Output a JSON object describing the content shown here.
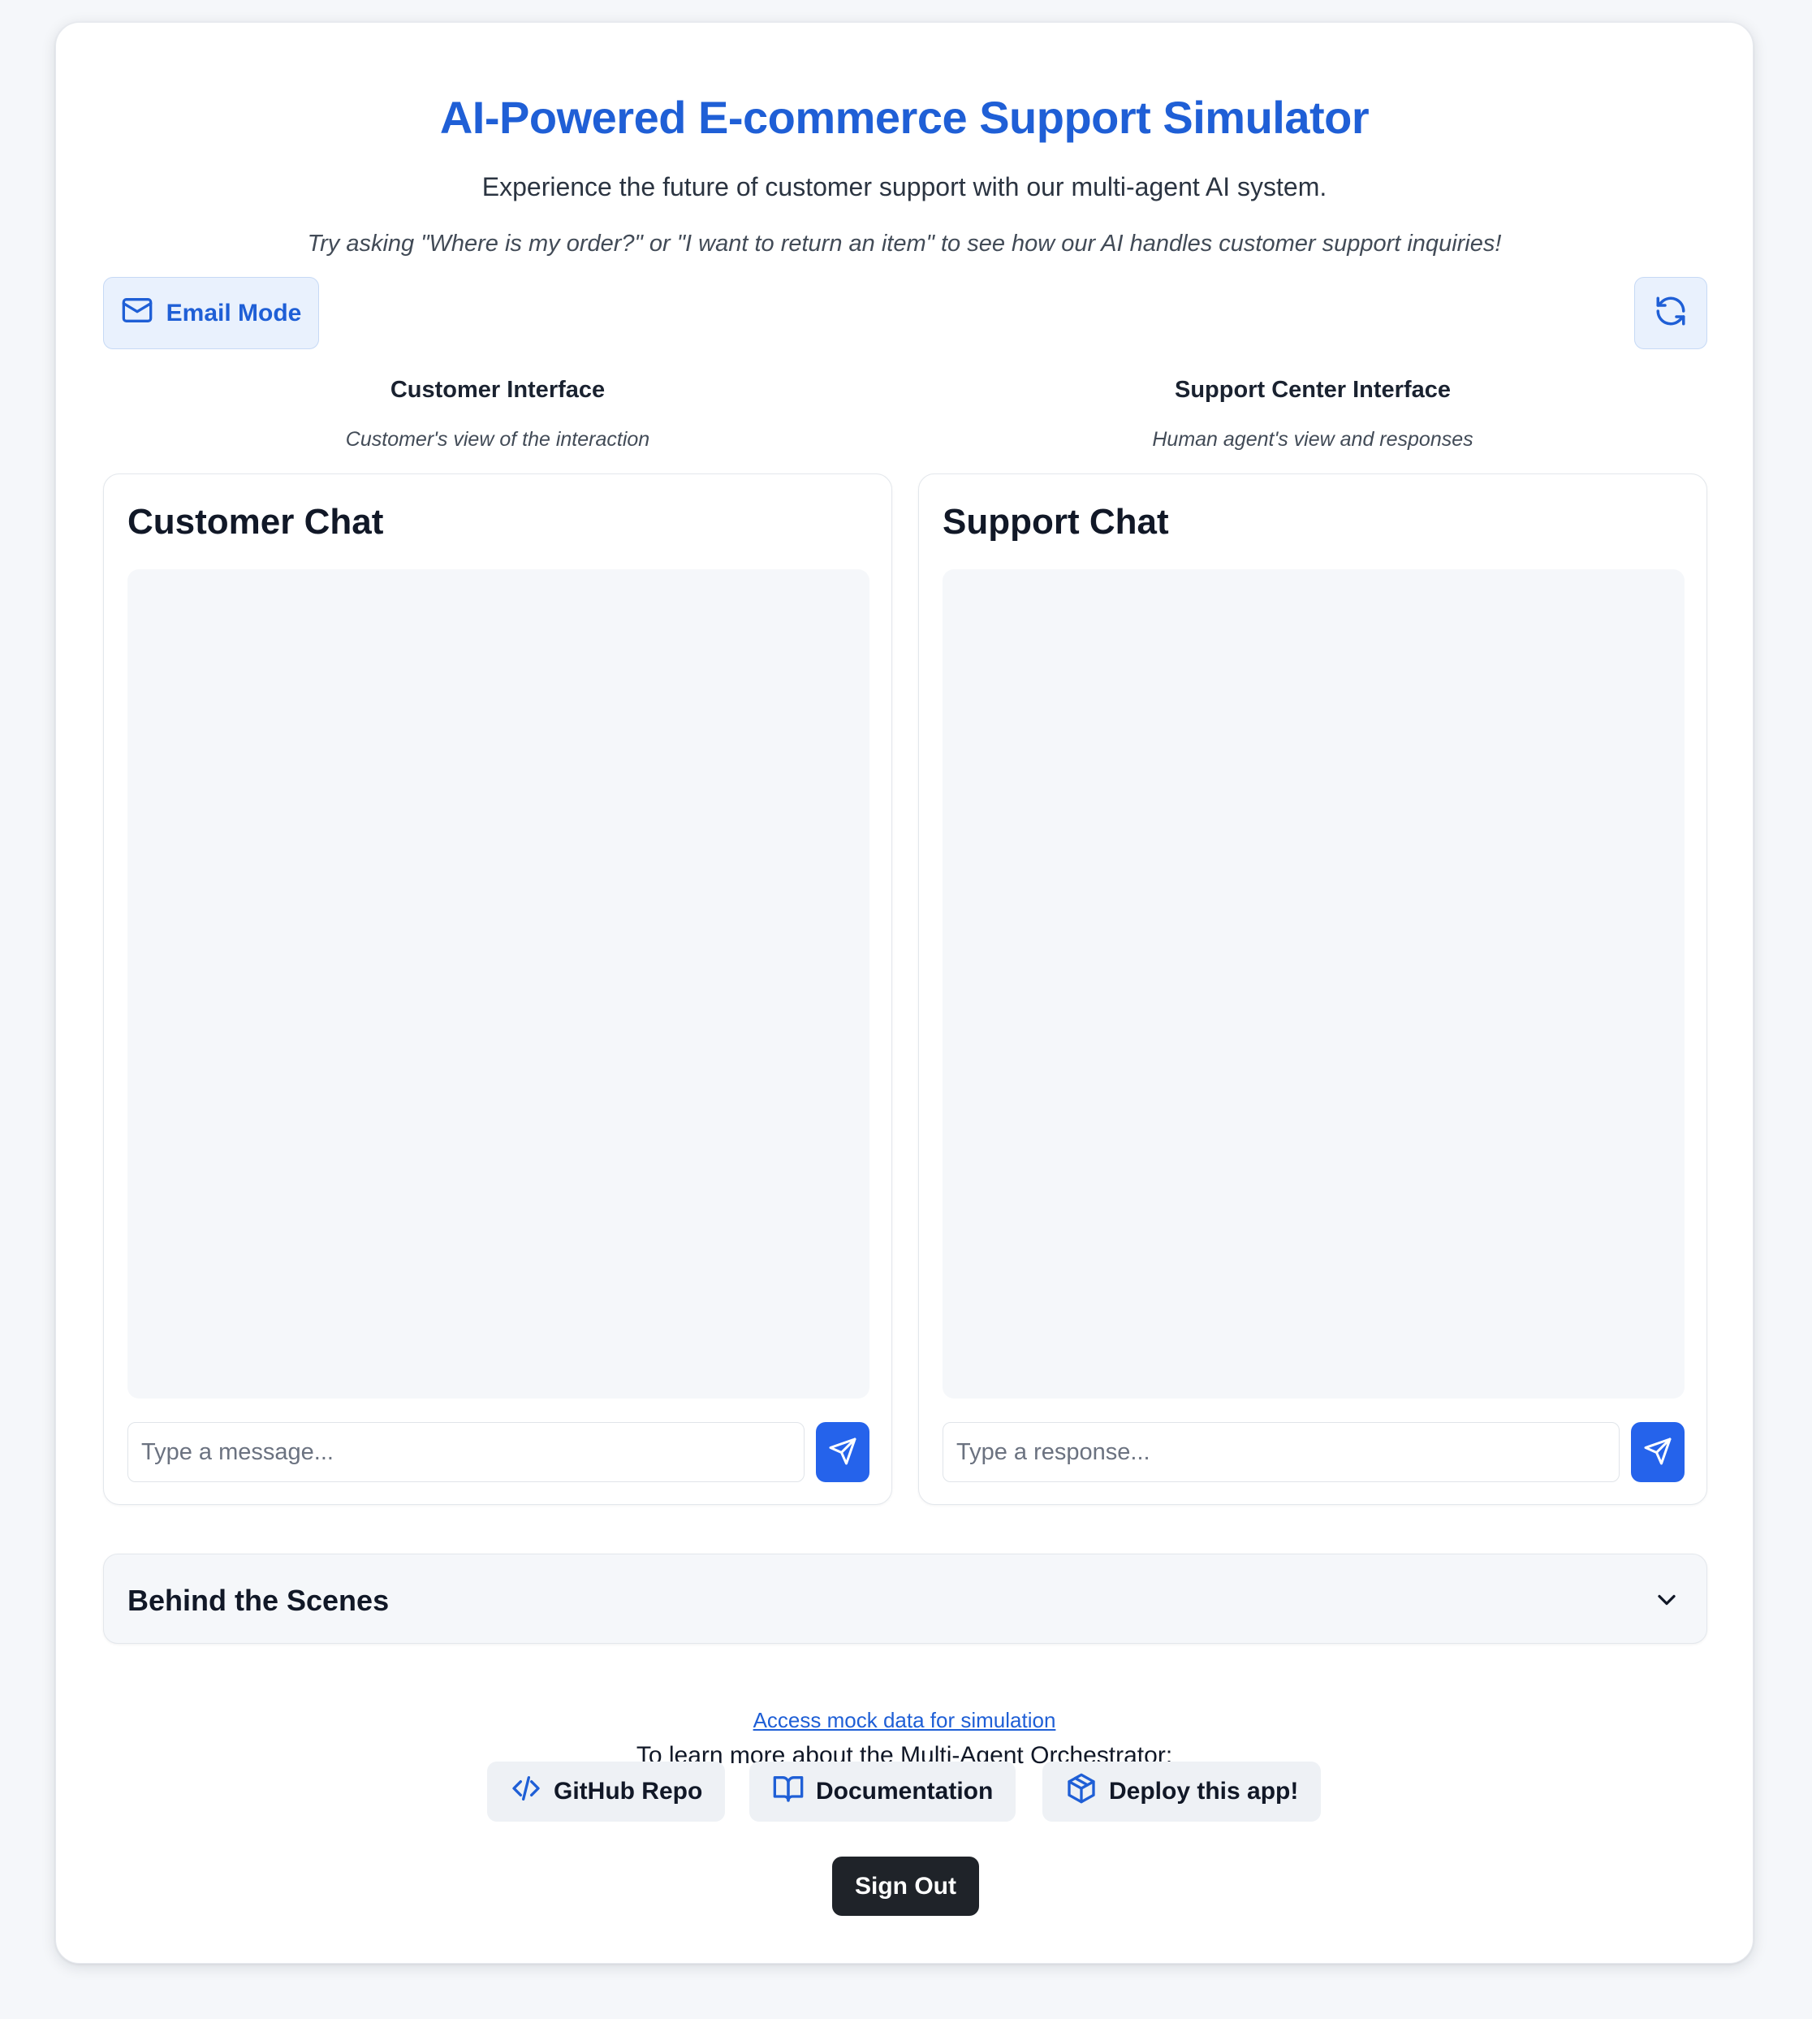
{
  "header": {
    "title": "AI-Powered E-commerce Support Simulator",
    "subtitle": "Experience the future of customer support with our multi-agent AI system.",
    "hint": "Try asking \"Where is my order?\" or \"I want to return an item\" to see how our AI handles customer support inquiries!"
  },
  "toolbar": {
    "email_mode_label": "Email Mode",
    "email_icon": "mail-icon",
    "refresh_icon": "refresh-icon"
  },
  "columns": {
    "customer": {
      "heading": "Customer Interface",
      "caption": "Customer's view of the interaction",
      "panel_title": "Customer Chat",
      "input_placeholder": "Type a message..."
    },
    "support": {
      "heading": "Support Center Interface",
      "caption": "Human agent's view and responses",
      "panel_title": "Support Chat",
      "input_placeholder": "Type a response..."
    }
  },
  "behind_scenes": {
    "label": "Behind the Scenes",
    "icon": "chevron-down-icon"
  },
  "footer": {
    "mock_link": "Access mock data for simulation",
    "learn_more": "To learn more about the Multi-Agent Orchestrator:",
    "links": [
      {
        "label": "GitHub Repo",
        "icon": "code-icon"
      },
      {
        "label": "Documentation",
        "icon": "book-icon"
      },
      {
        "label": "Deploy this app!",
        "icon": "package-icon"
      }
    ],
    "sign_out": "Sign Out"
  },
  "colors": {
    "accent": "#1f5fd6",
    "send_button": "#2563eb",
    "sign_out_bg": "#1f2329"
  }
}
